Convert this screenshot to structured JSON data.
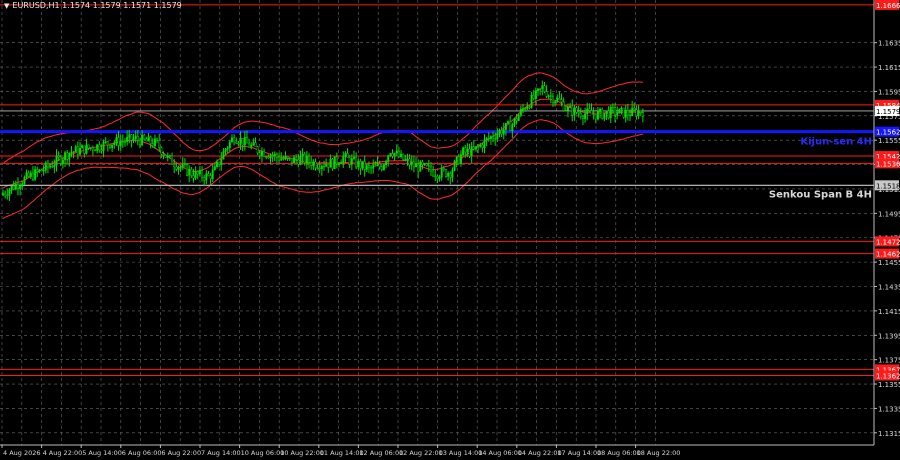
{
  "header": {
    "symbol_info": "EURUSD,H1  1.1574 1.1579 1.1571 1.1579"
  },
  "chart_data": {
    "type": "candlestick",
    "symbol": "EURUSD",
    "timeframe": "H1",
    "ohlc_readout": {
      "open": 1.1574,
      "high": 1.1579,
      "low": 1.1571,
      "close": 1.1579
    },
    "ylim": [
      1.1305,
      1.167
    ],
    "y_ticks": [
      "1.1315",
      "1.1335",
      "1.1355",
      "1.1375",
      "1.1395",
      "1.1415",
      "1.1435",
      "1.1455",
      "1.1475",
      "1.1495",
      "1.1515",
      "1.1535",
      "1.1555",
      "1.1575",
      "1.1595",
      "1.1615",
      "1.1635"
    ],
    "x_ticks": [
      "4 Aug 2026",
      "4 Aug 22:00",
      "5 Aug 14:00",
      "6 Aug 06:00",
      "6 Aug 22:00",
      "7 Aug 14:00",
      "10 Aug 06:00",
      "10 Aug 22:00",
      "11 Aug 14:00",
      "12 Aug 06:00",
      "12 Aug 22:00",
      "13 Aug 14:00",
      "14 Aug 06:00",
      "14 Aug 22:00",
      "17 Aug 14:00",
      "18 Aug 06:00",
      "18 Aug 22:00"
    ],
    "grid": true,
    "price_levels": [
      {
        "label": "1.1666",
        "value": 1.1666
      },
      {
        "label": "1.1584",
        "value": 1.1584
      },
      {
        "label": "1.1542",
        "value": 1.1542
      },
      {
        "label": "1.1536",
        "value": 1.1536
      },
      {
        "label": "1.1472",
        "value": 1.1472
      },
      {
        "label": "1.1462",
        "value": 1.1462
      },
      {
        "label": "1.1367",
        "value": 1.1367
      },
      {
        "label": "1.1362",
        "value": 1.1362
      }
    ],
    "kijun_sen": {
      "label": "Kijun-sen 4H",
      "value": 1.1562
    },
    "senkou_span_b": {
      "label": "Senkou Span B 4H",
      "value": 1.1518
    },
    "current_price": {
      "label": "1.1579",
      "value": 1.1579
    },
    "close_path": [
      [
        0,
        1.151
      ],
      [
        10,
        1.1522
      ],
      [
        22,
        1.1533
      ],
      [
        32,
        1.1545
      ],
      [
        42,
        1.1549
      ],
      [
        52,
        1.1553
      ],
      [
        63,
        1.1556
      ],
      [
        73,
        1.1552
      ],
      [
        78,
        1.154
      ],
      [
        84,
        1.1533
      ],
      [
        90,
        1.1527
      ],
      [
        97,
        1.1525
      ],
      [
        100,
        1.153
      ],
      [
        105,
        1.1548
      ],
      [
        109,
        1.1558
      ],
      [
        114,
        1.1553
      ],
      [
        120,
        1.1547
      ],
      [
        128,
        1.1542
      ],
      [
        135,
        1.1538
      ],
      [
        140,
        1.154
      ],
      [
        147,
        1.1536
      ],
      [
        155,
        1.1536
      ],
      [
        160,
        1.1541
      ],
      [
        166,
        1.1536
      ],
      [
        172,
        1.1531
      ],
      [
        178,
        1.1534
      ],
      [
        182,
        1.1547
      ],
      [
        187,
        1.154
      ],
      [
        193,
        1.1534
      ],
      [
        198,
        1.1532
      ],
      [
        204,
        1.1528
      ],
      [
        210,
        1.1529
      ],
      [
        216,
        1.1545
      ],
      [
        221,
        1.1546
      ],
      [
        227,
        1.1555
      ],
      [
        233,
        1.1562
      ],
      [
        239,
        1.1568
      ],
      [
        245,
        1.1583
      ],
      [
        250,
        1.1591
      ],
      [
        253,
        1.1598
      ],
      [
        257,
        1.1591
      ],
      [
        261,
        1.1587
      ],
      [
        265,
        1.158
      ],
      [
        272,
        1.1577
      ],
      [
        279,
        1.1576
      ],
      [
        286,
        1.1578
      ],
      [
        293,
        1.1577
      ],
      [
        300,
        1.1579
      ]
    ],
    "bands_offset": 0.002
  }
}
